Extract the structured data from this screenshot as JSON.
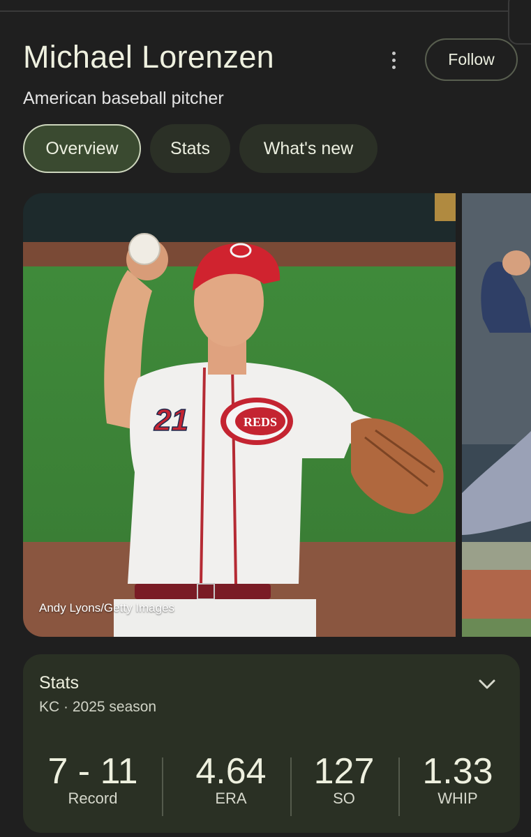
{
  "header": {
    "name": "Michael Lorenzen",
    "description": "American baseball pitcher",
    "follow_label": "Follow",
    "more_icon": "more-vert-icon"
  },
  "tabs": [
    {
      "label": "Overview",
      "active": true
    },
    {
      "label": "Stats",
      "active": false
    },
    {
      "label": "What's new",
      "active": false
    }
  ],
  "images": {
    "credit": "Andy Lyons/Getty Images",
    "jersey_number": "21",
    "logo_text": "REDS"
  },
  "stats": {
    "title": "Stats",
    "subtitle": "KC · 2025 season",
    "expand_icon": "chevron-down-icon",
    "items": [
      {
        "value": "7 - 11",
        "label": "Record"
      },
      {
        "value": "4.64",
        "label": "ERA"
      },
      {
        "value": "127",
        "label": "SO"
      },
      {
        "value": "1.33",
        "label": "WHIP"
      }
    ]
  },
  "colors": {
    "background": "#1f1f1f",
    "active_chip": "#3a4a30",
    "chip": "#2b3026",
    "card": "#2a3024",
    "reds_red": "#d0232f"
  }
}
